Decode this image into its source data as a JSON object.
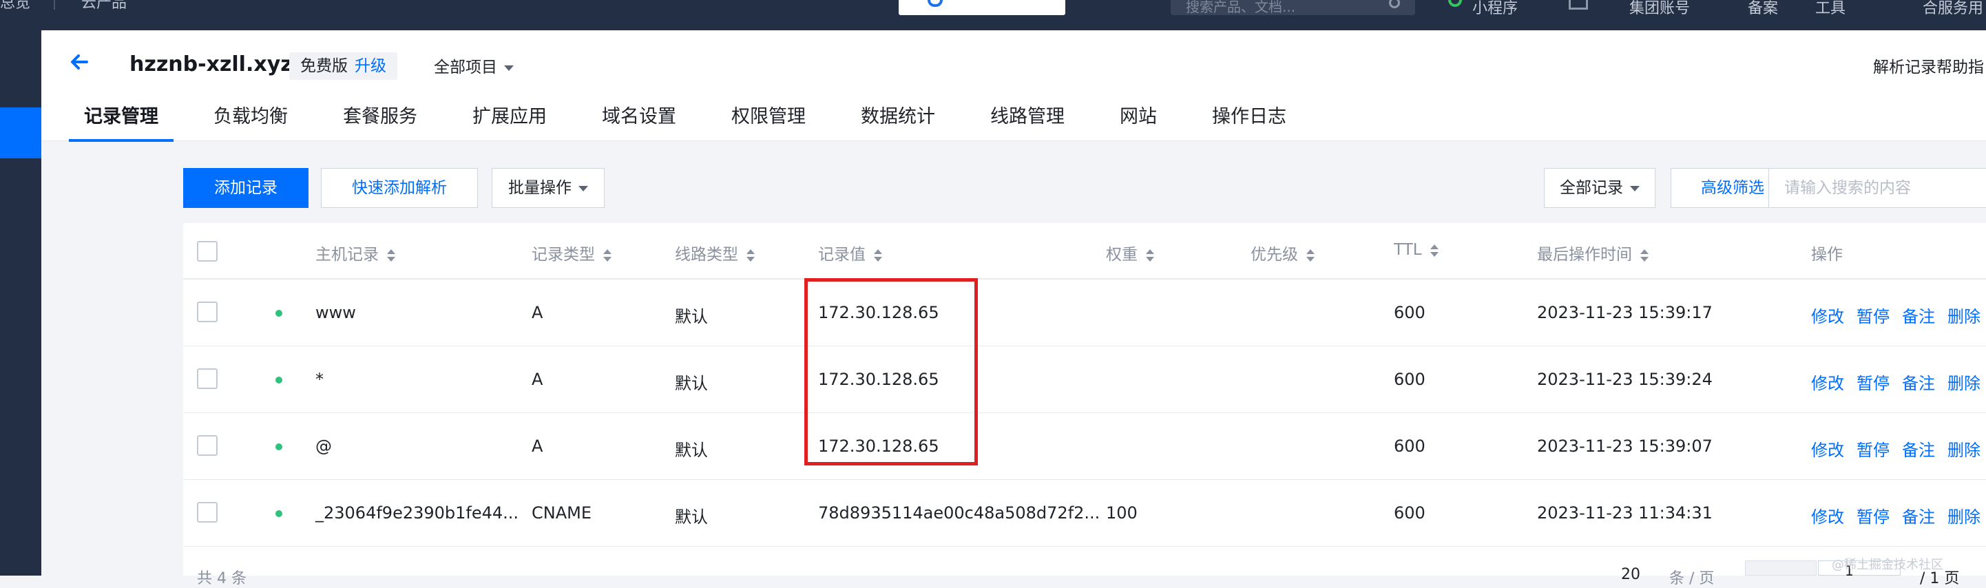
{
  "topbar": {
    "crumb_left": "总览",
    "crumb_products": "云产品",
    "search_placeholder": "搜索产品、文档...",
    "items": [
      "小程序",
      "集团账号",
      "备案",
      "工具",
      "合服务用"
    ]
  },
  "header": {
    "domain": "hzznb-xzll.xyz",
    "plan": "免费版",
    "upgrade": "升级",
    "project": "全部项目",
    "help": "解析记录帮助指"
  },
  "tabs": [
    "记录管理",
    "负载均衡",
    "套餐服务",
    "扩展应用",
    "域名设置",
    "权限管理",
    "数据统计",
    "线路管理",
    "网站",
    "操作日志"
  ],
  "toolbar": {
    "add_record": "添加记录",
    "quick_add": "快速添加解析",
    "batch": "批量操作",
    "filter_all": "全部记录",
    "advanced": "高级筛选",
    "search_placeholder": "请输入搜索的内容"
  },
  "table": {
    "headers": [
      "主机记录",
      "记录类型",
      "线路类型",
      "记录值",
      "权重",
      "优先级",
      "TTL",
      "最后操作时间",
      "操作"
    ],
    "rows": [
      {
        "host": "www",
        "type": "A",
        "line": "默认",
        "value": "172.30.128.65",
        "weight": "",
        "priority": "",
        "ttl": "600",
        "time": "2023-11-23 15:39:17"
      },
      {
        "host": "*",
        "type": "A",
        "line": "默认",
        "value": "172.30.128.65",
        "weight": "",
        "priority": "",
        "ttl": "600",
        "time": "2023-11-23 15:39:24"
      },
      {
        "host": "@",
        "type": "A",
        "line": "默认",
        "value": "172.30.128.65",
        "weight": "",
        "priority": "",
        "ttl": "600",
        "time": "2023-11-23 15:39:07"
      },
      {
        "host": "_23064f9e2390b1fe44...",
        "type": "CNAME",
        "line": "默认",
        "value": "78d8935114ae00c48a508d72f2...",
        "weight": "100",
        "priority": "",
        "ttl": "600",
        "time": "2023-11-23 11:34:31"
      }
    ],
    "actions": [
      "修改",
      "暂停",
      "备注",
      "删除"
    ]
  },
  "footer": {
    "total": "共 4 条",
    "per_page": "20",
    "per_page_label": "条 / 页",
    "page": "1",
    "page_total": "/ 1 页"
  },
  "watermark": "@稀土掘金技术社区",
  "colors": {
    "accent": "#006eff",
    "topbar": "#232f45",
    "highlight": "#e02020",
    "status_ok": "#2ec27e"
  }
}
